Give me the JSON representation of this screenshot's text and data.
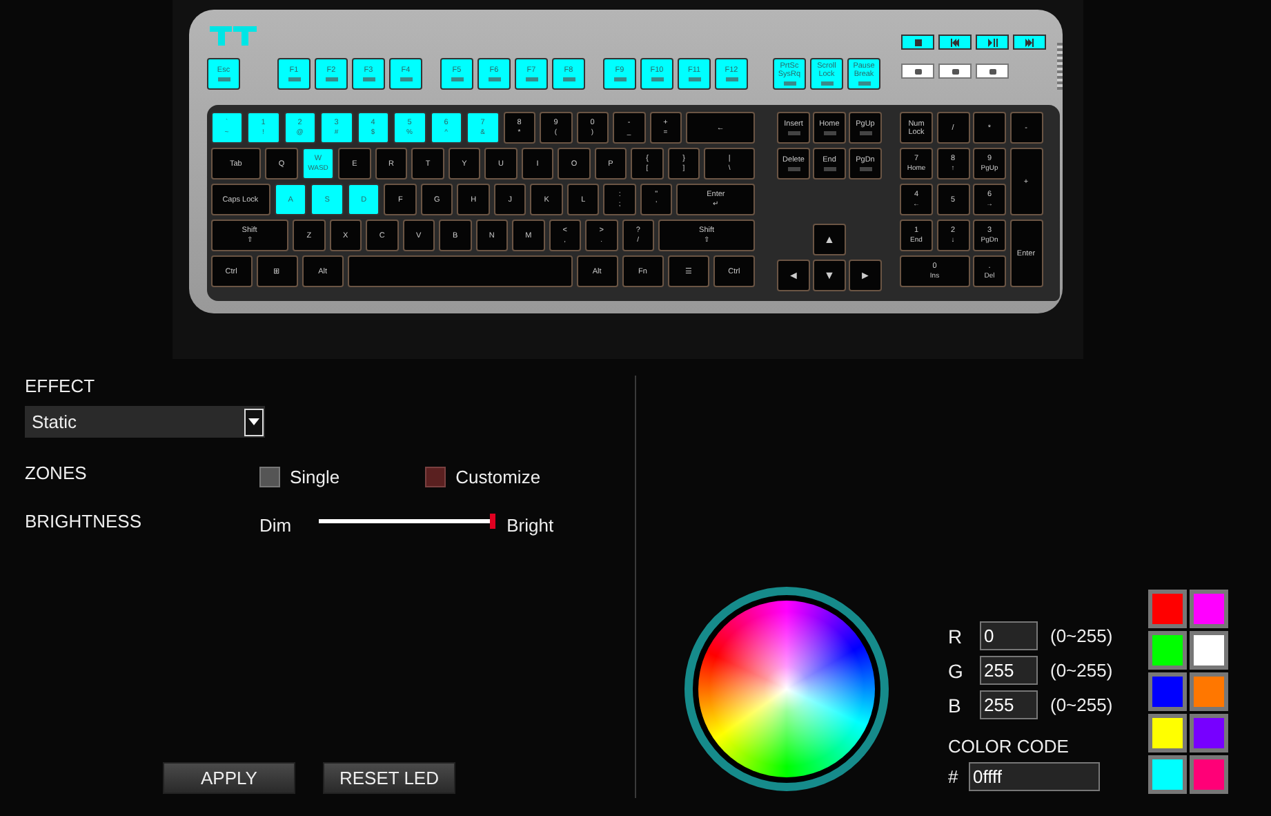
{
  "keyboard": {
    "function_groups": [
      {
        "keys": [
          {
            "label": "Esc",
            "lit": true
          }
        ]
      },
      {
        "keys": [
          {
            "label": "F1",
            "lit": true
          },
          {
            "label": "F2",
            "lit": true
          },
          {
            "label": "F3",
            "lit": true
          },
          {
            "label": "F4",
            "lit": true
          }
        ]
      },
      {
        "keys": [
          {
            "label": "F5",
            "lit": true
          },
          {
            "label": "F6",
            "lit": true
          },
          {
            "label": "F7",
            "lit": true
          },
          {
            "label": "F8",
            "lit": true
          }
        ]
      },
      {
        "keys": [
          {
            "label": "F9",
            "lit": true
          },
          {
            "label": "F10",
            "lit": true
          },
          {
            "label": "F11",
            "lit": true
          },
          {
            "label": "F12",
            "lit": true
          }
        ]
      },
      {
        "keys": [
          {
            "label": "PrtSc SysRq",
            "lit": true
          },
          {
            "label": "Scroll Lock",
            "lit": true
          },
          {
            "label": "Pause Break",
            "lit": true
          }
        ]
      }
    ],
    "media_keys": [
      {
        "kind": "stop",
        "lit": true
      },
      {
        "kind": "prev",
        "lit": true
      },
      {
        "kind": "play",
        "lit": true
      },
      {
        "kind": "next",
        "lit": true
      }
    ],
    "main_rows": [
      {
        "keys": [
          {
            "label": "`",
            "sub": "~",
            "kind": "key",
            "lit": true
          },
          {
            "label": "1",
            "sub": "!",
            "kind": "key",
            "lit": true
          },
          {
            "label": "2",
            "sub": "@",
            "kind": "key",
            "lit": true
          },
          {
            "label": "3",
            "sub": "#",
            "kind": "key",
            "lit": true
          },
          {
            "label": "4",
            "sub": "$",
            "kind": "key",
            "lit": true
          },
          {
            "label": "5",
            "sub": "%",
            "kind": "key",
            "lit": true
          },
          {
            "label": "6",
            "sub": "^",
            "kind": "key",
            "lit": true
          },
          {
            "label": "7",
            "sub": "&",
            "kind": "key",
            "lit": true
          },
          {
            "label": "8",
            "sub": "*",
            "kind": "key",
            "lit": false
          },
          {
            "label": "9",
            "sub": "(",
            "kind": "key",
            "lit": false
          },
          {
            "label": "0",
            "sub": ")",
            "kind": "key",
            "lit": false
          },
          {
            "label": "-",
            "sub": "_",
            "kind": "key",
            "lit": false
          },
          {
            "label": "+",
            "sub": "=",
            "kind": "key",
            "lit": false
          },
          {
            "label": "←",
            "kind": "backspace",
            "lit": false
          }
        ]
      },
      {
        "keys": [
          {
            "label": "Tab",
            "kind": "tab",
            "lit": false
          },
          {
            "label": "Q",
            "kind": "key",
            "lit": false
          },
          {
            "label": "W",
            "sub": "WASD",
            "kind": "key",
            "lit": true
          },
          {
            "label": "E",
            "kind": "key",
            "lit": false
          },
          {
            "label": "R",
            "kind": "key",
            "lit": false
          },
          {
            "label": "T",
            "kind": "key",
            "lit": false
          },
          {
            "label": "Y",
            "kind": "key",
            "lit": false
          },
          {
            "label": "U",
            "kind": "key",
            "lit": false
          },
          {
            "label": "I",
            "kind": "key",
            "lit": false
          },
          {
            "label": "O",
            "kind": "key",
            "lit": false
          },
          {
            "label": "P",
            "kind": "key",
            "lit": false
          },
          {
            "label": "{",
            "sub": "[",
            "kind": "key",
            "lit": false
          },
          {
            "label": "}",
            "sub": "]",
            "kind": "key",
            "lit": false
          },
          {
            "label": "|",
            "sub": "\\",
            "kind": "wide",
            "lit": false
          }
        ]
      },
      {
        "keys": [
          {
            "label": "Caps Lock",
            "kind": "caps",
            "lit": false
          },
          {
            "label": "A",
            "kind": "key",
            "lit": true
          },
          {
            "label": "S",
            "kind": "key",
            "lit": true
          },
          {
            "label": "D",
            "kind": "key",
            "lit": true
          },
          {
            "label": "F",
            "kind": "key",
            "lit": false
          },
          {
            "label": "G",
            "kind": "key",
            "lit": false
          },
          {
            "label": "H",
            "kind": "key",
            "lit": false
          },
          {
            "label": "J",
            "kind": "key",
            "lit": false
          },
          {
            "label": "K",
            "kind": "key",
            "lit": false
          },
          {
            "label": "L",
            "kind": "key",
            "lit": false
          },
          {
            "label": ":",
            "sub": ";",
            "kind": "key",
            "lit": false
          },
          {
            "label": "\"",
            "sub": "'",
            "kind": "key",
            "lit": false
          },
          {
            "label": "Enter",
            "sub": "↵",
            "kind": "enter",
            "lit": false
          }
        ]
      },
      {
        "keys": [
          {
            "label": "Shift",
            "sub": "⇧",
            "kind": "lshift",
            "lit": false
          },
          {
            "label": "Z",
            "kind": "key",
            "lit": false
          },
          {
            "label": "X",
            "kind": "key",
            "lit": false
          },
          {
            "label": "C",
            "kind": "key",
            "lit": false
          },
          {
            "label": "V",
            "kind": "key",
            "lit": false
          },
          {
            "label": "B",
            "kind": "key",
            "lit": false
          },
          {
            "label": "N",
            "kind": "key",
            "lit": false
          },
          {
            "label": "M",
            "kind": "key",
            "lit": false
          },
          {
            "label": "<",
            "sub": ",",
            "kind": "key",
            "lit": false
          },
          {
            "label": ">",
            "sub": ".",
            "kind": "key",
            "lit": false
          },
          {
            "label": "?",
            "sub": "/",
            "kind": "key",
            "lit": false
          },
          {
            "label": "Shift",
            "sub": "⇧",
            "kind": "rshift",
            "lit": false
          }
        ]
      },
      {
        "keys": [
          {
            "label": "Ctrl",
            "kind": "mod",
            "lit": false
          },
          {
            "label": "⊞",
            "kind": "mod",
            "lit": false
          },
          {
            "label": "Alt",
            "kind": "mod",
            "lit": false
          },
          {
            "kind": "space",
            "lit": false
          },
          {
            "label": "Alt",
            "kind": "mod",
            "lit": false
          },
          {
            "label": "Fn",
            "kind": "mod",
            "lit": false
          },
          {
            "label": "☰",
            "kind": "mod",
            "lit": false
          },
          {
            "label": "Ctrl",
            "kind": "mod",
            "lit": false
          }
        ]
      }
    ],
    "nav_keys": [
      {
        "label": "Insert",
        "lit": false
      },
      {
        "label": "Home",
        "lit": false
      },
      {
        "label": "PgUp",
        "lit": false
      },
      {
        "label": "Delete",
        "lit": false
      },
      {
        "label": "End",
        "lit": false
      },
      {
        "label": "PgDn",
        "lit": false
      }
    ],
    "arrow_keys": [
      {
        "label": "▲",
        "lit": false
      },
      {
        "label": "◄",
        "lit": false
      },
      {
        "label": "▼",
        "lit": false
      },
      {
        "label": "►",
        "lit": false
      }
    ],
    "numpad_keys": [
      {
        "label": "Num Lock",
        "kind": "key",
        "lit": false
      },
      {
        "label": "/",
        "kind": "key",
        "lit": false
      },
      {
        "label": "*",
        "kind": "key",
        "lit": false
      },
      {
        "label": "-",
        "kind": "key",
        "lit": false
      },
      {
        "label": "7",
        "sub": "Home",
        "kind": "key",
        "lit": false
      },
      {
        "label": "8",
        "sub": "↑",
        "kind": "key",
        "lit": false
      },
      {
        "label": "9",
        "sub": "PgUp",
        "kind": "key",
        "lit": false
      },
      {
        "label": "+",
        "kind": "tall",
        "lit": false
      },
      {
        "label": "4",
        "sub": "←",
        "kind": "key",
        "lit": false
      },
      {
        "label": "5",
        "kind": "key",
        "lit": false
      },
      {
        "label": "6",
        "sub": "→",
        "kind": "key",
        "lit": false
      },
      {
        "label": "1",
        "sub": "End",
        "kind": "key",
        "lit": false
      },
      {
        "label": "2",
        "sub": "↓",
        "kind": "key",
        "lit": false
      },
      {
        "label": "3",
        "sub": "PgDn",
        "kind": "key",
        "lit": false
      },
      {
        "label": "Enter",
        "kind": "tall",
        "lit": false
      },
      {
        "label": "0",
        "sub": "Ins",
        "kind": "wide",
        "lit": false
      },
      {
        "label": ".",
        "sub": "Del",
        "kind": "key",
        "lit": false
      }
    ]
  },
  "effect": {
    "label": "EFFECT",
    "value": "Static"
  },
  "zones": {
    "label": "ZONES",
    "options": [
      {
        "label": "Single",
        "selected": false
      },
      {
        "label": "Customize",
        "selected": true
      }
    ]
  },
  "brightness": {
    "label": "BRIGHTNESS",
    "min_label": "Dim",
    "max_label": "Bright",
    "level": 1
  },
  "buttons": [
    "APPLY",
    "RESET LED"
  ],
  "rgb": [
    {
      "label": "R",
      "value": "0",
      "range": "(0~255)"
    },
    {
      "label": "G",
      "value": "255",
      "range": "(0~255)"
    },
    {
      "label": "B",
      "value": "255",
      "range": "(0~255)"
    }
  ],
  "color_code": {
    "label": "COLOR CODE",
    "prefix": "#",
    "value": "0ffff"
  },
  "swatches": [
    {
      "color": "#ff0000"
    },
    {
      "color": "#ff00ff"
    },
    {
      "color": "#00ff00"
    },
    {
      "color": "#ffffff"
    },
    {
      "color": "#0000ff"
    },
    {
      "color": "#ff7700"
    },
    {
      "color": "#ffff00"
    },
    {
      "color": "#7700ff"
    },
    {
      "color": "#00ffff"
    },
    {
      "color": "#ff0077"
    }
  ]
}
